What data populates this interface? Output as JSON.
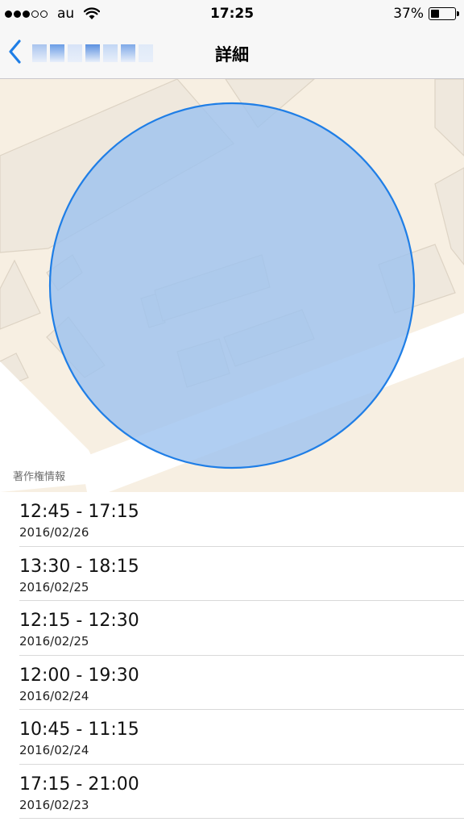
{
  "status_bar": {
    "signal_dots_on": 3,
    "signal_dots_total": 5,
    "carrier": "au",
    "time": "17:25",
    "battery_percent": "37%",
    "battery_level": 0.37
  },
  "nav": {
    "title": "詳細",
    "back_icon": "chevron-left-icon",
    "back_label_blurred": true,
    "back_label_colors": [
      "#a9c4ee",
      "#6a9de6",
      "#d7e3f7",
      "#5b90e0",
      "#c2d6f4",
      "#7ea9e8",
      "#e0eaf8"
    ]
  },
  "map": {
    "credit": "著作権情報",
    "colors": {
      "land": "#f7efe2",
      "building": "#eee7dc",
      "building_stroke": "#ddd3c4",
      "road": "#ffffff",
      "region_fill": "#9fc3ef",
      "region_stroke": "#1f7ee6"
    }
  },
  "visits": [
    {
      "time": "12:45 - 17:15",
      "date": "2016/02/26"
    },
    {
      "time": "13:30 - 18:15",
      "date": "2016/02/25"
    },
    {
      "time": "12:15 - 12:30",
      "date": "2016/02/25"
    },
    {
      "time": "12:00 - 19:30",
      "date": "2016/02/24"
    },
    {
      "time": "10:45 - 11:15",
      "date": "2016/02/24"
    },
    {
      "time": "17:15 - 21:00",
      "date": "2016/02/23"
    }
  ]
}
